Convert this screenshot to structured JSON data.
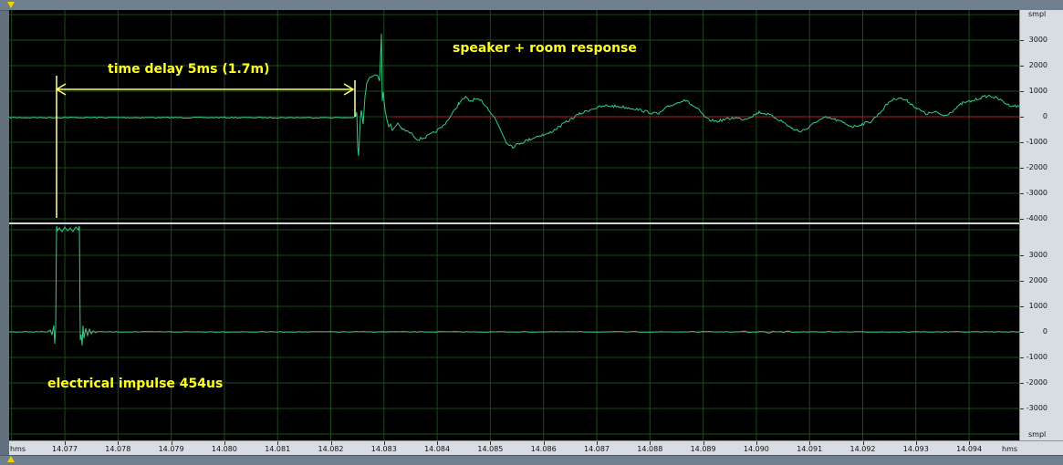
{
  "annotations": {
    "time_delay": "time delay 5ms (1.7m)",
    "speaker_room": "speaker + room response",
    "electrical_impulse": "electrical impulse 454us"
  },
  "ruler": {
    "unit": "smpl",
    "top_labels": [
      "3000",
      "2000",
      "1000",
      "0",
      "-1000",
      "-2000",
      "-3000",
      "-4000"
    ],
    "bottom_labels": [
      "3000",
      "2000",
      "1000",
      "0",
      "-1000",
      "-2000",
      "-3000"
    ]
  },
  "timeline": {
    "unit_left": "hms",
    "unit_right": "hms",
    "labels": [
      "14.077",
      "14.078",
      "14.079",
      "14.080",
      "14.081",
      "14.082",
      "14.083",
      "14.084",
      "14.085",
      "14.086",
      "14.087",
      "14.088",
      "14.089",
      "14.090",
      "14.091",
      "14.092",
      "14.093",
      "14.094"
    ]
  },
  "colors": {
    "waveform": "#33cc88",
    "zero_line": "#b02020",
    "grid": "#1c4a1c",
    "annotation": "#ffff22",
    "cursor": "#f4d000"
  }
}
